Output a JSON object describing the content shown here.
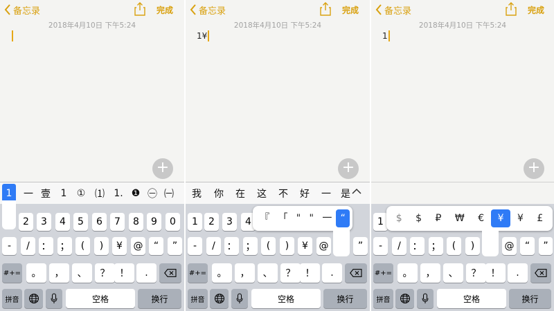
{
  "header": {
    "back_label": "备忘录",
    "done_label": "完成",
    "date": "2018年4月10日 下午5:24"
  },
  "panels": [
    {
      "note_text": ""
    },
    {
      "note_text": "1¥"
    },
    {
      "note_text": "1"
    }
  ],
  "keyboard": {
    "row_number": [
      "1",
      "2",
      "3",
      "4",
      "5",
      "6",
      "7",
      "8",
      "9",
      "0"
    ],
    "row_symbols": [
      "-",
      "/",
      "：",
      "；",
      "(",
      ")",
      "¥",
      "@",
      "“",
      "”"
    ],
    "row_punct": [
      "。",
      "，",
      "、",
      "？",
      "！",
      "."
    ],
    "mode_key": "#+=",
    "pinyin_key": "拼音",
    "space_key": "空格",
    "return_key": "换行"
  },
  "panel1": {
    "candidates": [
      "1",
      "一",
      "壹",
      "1",
      "①",
      "⑴",
      "1.",
      "❶",
      "㊀",
      "㈠"
    ]
  },
  "panel2": {
    "candidates": [
      "我",
      "你",
      "在",
      "这",
      "不",
      "好",
      "一",
      "是"
    ],
    "popup": [
      "『",
      "「",
      "\"",
      "\"",
      "一",
      "“"
    ],
    "popup_selected": 5
  },
  "panel3": {
    "popup": [
      "$",
      "$",
      "₽",
      "₩",
      "€",
      "¥",
      "¥",
      "£"
    ],
    "popup_selected": 5
  },
  "icons": {
    "back": "chevron-left-icon",
    "share": "share-icon",
    "plus": "plus-icon",
    "globe": "globe-icon",
    "mic": "microphone-icon",
    "delete": "backspace-icon",
    "chevron_up": "chevron-up-icon"
  },
  "colors": {
    "accent": "#d9a10f",
    "selection": "#2f7bf6",
    "keyboard_bg": "#d2d5db"
  }
}
